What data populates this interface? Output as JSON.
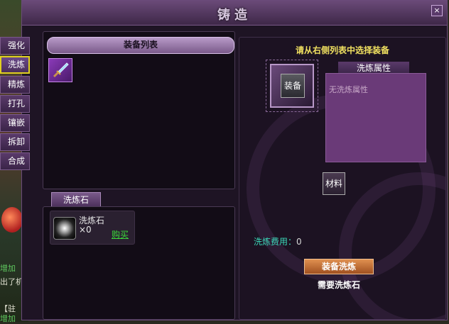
{
  "window": {
    "title": "铸造",
    "close_label": "×"
  },
  "tabs": [
    "强化",
    "洗炼",
    "精炼",
    "打孔",
    "镶嵌",
    "拆卸",
    "合成"
  ],
  "active_tab_index": 1,
  "equipment_list": {
    "header": "装备列表",
    "items": [
      {
        "icon": "sword-icon"
      }
    ]
  },
  "stone_section": {
    "tab_label": "洗炼石",
    "item_name": "洗炼石",
    "item_count": "×0",
    "buy_label": "购买"
  },
  "right_panel": {
    "hint": "请从右侧列表中选择装备",
    "equip_slot_label": "装备",
    "attr_title": "洗炼属性",
    "attr_empty": "无洗炼属性",
    "material_label": "材料",
    "cost_label": "洗炼费用：",
    "cost_value": "0",
    "refine_button": "装备洗炼",
    "requirement": "需要洗炼石"
  },
  "background_text": [
    "增加",
    "出了机",
    "【驻",
    "增加"
  ],
  "colors": {
    "highlight": "#e0d020",
    "buy_link": "#3ad83a",
    "cost_label": "#3ad8b8",
    "hint": "#f0e060"
  }
}
